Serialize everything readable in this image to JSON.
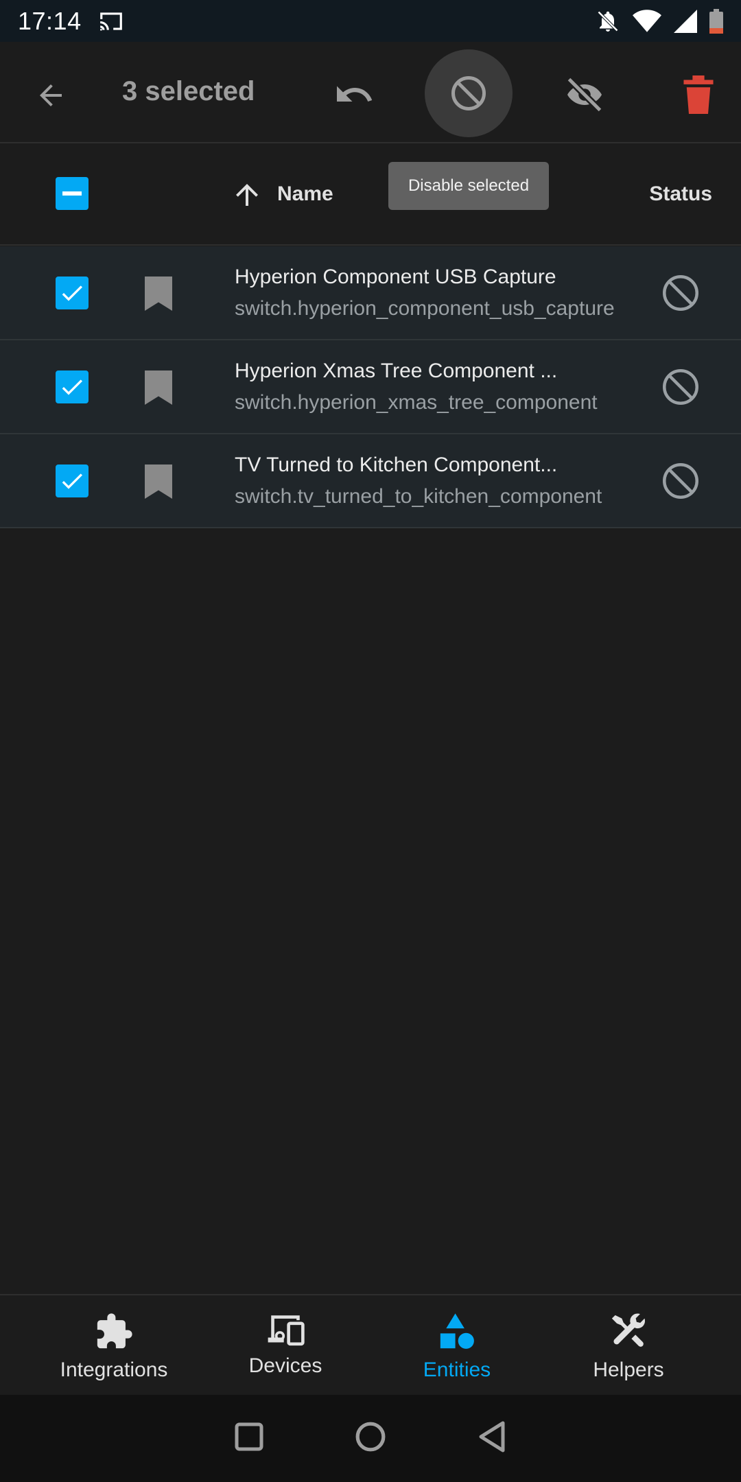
{
  "status_bar": {
    "time": "17:14",
    "icons": [
      "cast-icon",
      "notifications-off-icon",
      "wifi-icon",
      "signal-icon",
      "battery-icon"
    ]
  },
  "app_bar": {
    "title": "3 selected",
    "actions": [
      "back-arrow-icon",
      "restore-icon",
      "disable-icon",
      "hide-icon",
      "delete-icon"
    ],
    "delete_color": "#db4437"
  },
  "tooltip": {
    "text": "Disable selected"
  },
  "table": {
    "columns": {
      "name": "Name",
      "status": "Status"
    },
    "rows": [
      {
        "name": "Hyperion Component USB Capture",
        "entity_id": "switch.hyperion_component_usb_capture"
      },
      {
        "name": "Hyperion Xmas Tree Component ...",
        "entity_id": "switch.hyperion_xmas_tree_component"
      },
      {
        "name": "TV Turned to Kitchen Component...",
        "entity_id": "switch.tv_turned_to_kitchen_component"
      }
    ]
  },
  "bottom_nav": {
    "items": [
      {
        "label": "Integrations",
        "icon": "puzzle-icon"
      },
      {
        "label": "Devices",
        "icon": "devices-icon"
      },
      {
        "label": "Entities",
        "icon": "shapes-icon"
      },
      {
        "label": "Helpers",
        "icon": "tools-icon"
      }
    ],
    "active": "Entities"
  },
  "colors": {
    "accent": "#03a9f4",
    "background": "#1c1c1c",
    "row_background": "#20262a"
  }
}
